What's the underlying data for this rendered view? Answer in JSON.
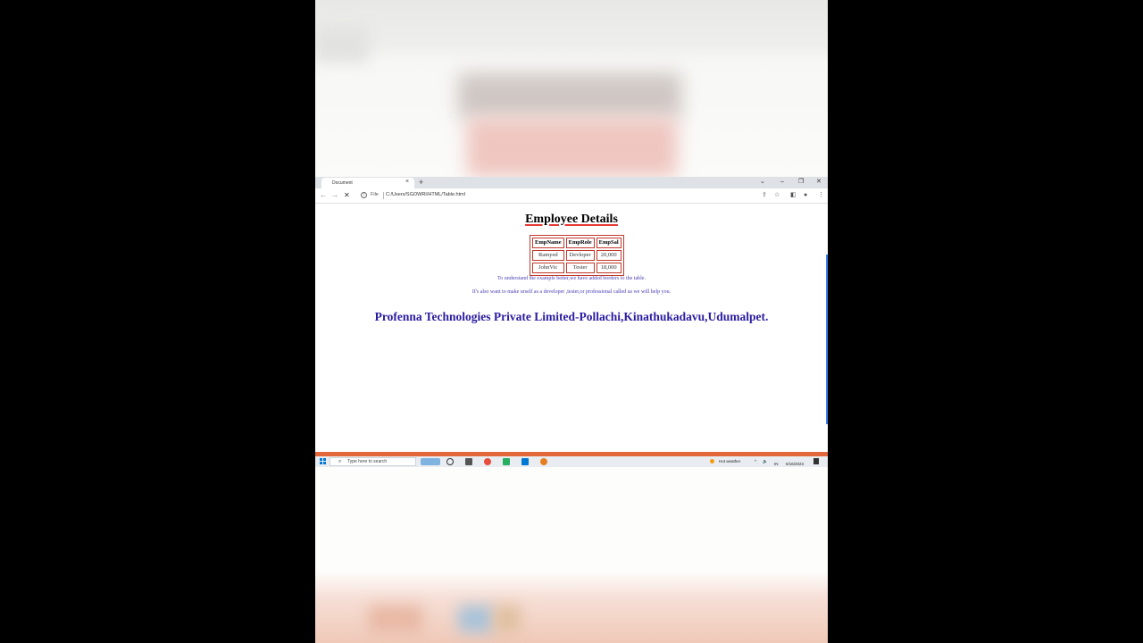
{
  "browser": {
    "tab_title": "Document",
    "tab_close": "×",
    "new_tab": "+",
    "window_controls": [
      "⌄",
      "–",
      "❐",
      "✕"
    ],
    "file_label": "File",
    "url": "C:/Users/SGOWRI/HTML/Table.html"
  },
  "page": {
    "heading": "Employee Details",
    "table": {
      "headers": [
        "EmpName",
        "EmpRole",
        "EmpSal"
      ],
      "rows": [
        [
          "Ramyed",
          "Devloper",
          "20,000"
        ],
        [
          "JohnVic",
          "Tester",
          "18,000"
        ]
      ]
    },
    "line1": "To understand the example better,we have added borders to the table.",
    "line2": "If's also want to make urself as a developer ,tester,or professional called us we will help you.",
    "company": "Profenna Technologies Private Limited-Pollachi,Kinathukadavu,Udumalpet."
  },
  "taskbar": {
    "search_placeholder": "Type here to search",
    "weather": "Hot weather",
    "date": "6/16/2023",
    "lang": "IN"
  },
  "colors": {
    "table_border": "#c0392b",
    "text_blue": "#4a3fb4",
    "company_blue": "#2a1ca0",
    "statusbar": "#e2673a"
  }
}
